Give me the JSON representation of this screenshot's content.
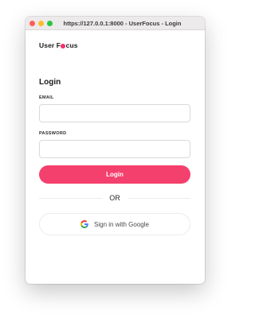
{
  "window": {
    "title": "https://127.0.0.1:8000 - UserFocus - Login"
  },
  "brand": {
    "name_part1": "User F",
    "name_part2": "cus",
    "accent_color": "#f0326a"
  },
  "form": {
    "heading": "Login",
    "email_label": "EMAIL",
    "email_value": "",
    "email_placeholder": "",
    "password_label": "PASSWORD",
    "password_value": "",
    "password_placeholder": "",
    "login_button": "Login",
    "divider_text": "OR",
    "google_button": "Sign in with Google",
    "google_icon": "google-g-icon"
  },
  "colors": {
    "primary_button": "#f4406c",
    "input_border": "#d9d9de"
  }
}
